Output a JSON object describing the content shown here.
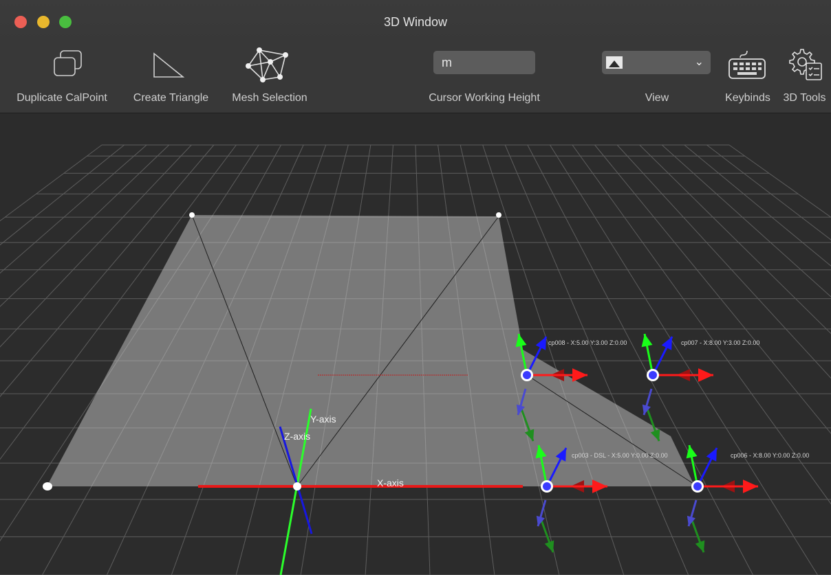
{
  "window": {
    "title": "3D Window"
  },
  "toolbar": {
    "duplicate_label": "Duplicate CalPoint",
    "triangle_label": "Create Triangle",
    "mesh_label": "Mesh Selection",
    "cursor_height_label": "Cursor Working Height",
    "cursor_height_value": "m",
    "view_label": "View",
    "keybinds_label": "Keybinds",
    "tools_label": "3D Tools"
  },
  "scene": {
    "x_axis_label": "X-axis",
    "y_axis_label": "Y-axis",
    "z_axis_label": "Z-axis",
    "calpoints": [
      {
        "label": "cp008 - X:5.00 Y:3.00 Z:0.00"
      },
      {
        "label": "cp007 - X:8.00 Y:3.00 Z:0.00"
      },
      {
        "label": "cp003 - DSL - X:5.00 Y:0.00 Z:0.00"
      },
      {
        "label": "cp006 - X:8.00 Y:0.00 Z:0.00"
      }
    ]
  },
  "colors": {
    "x_axis": "#ff1a1a",
    "y_axis": "#19ff19",
    "z_axis": "#1a1aff",
    "calpoint": "#3b3bff"
  }
}
